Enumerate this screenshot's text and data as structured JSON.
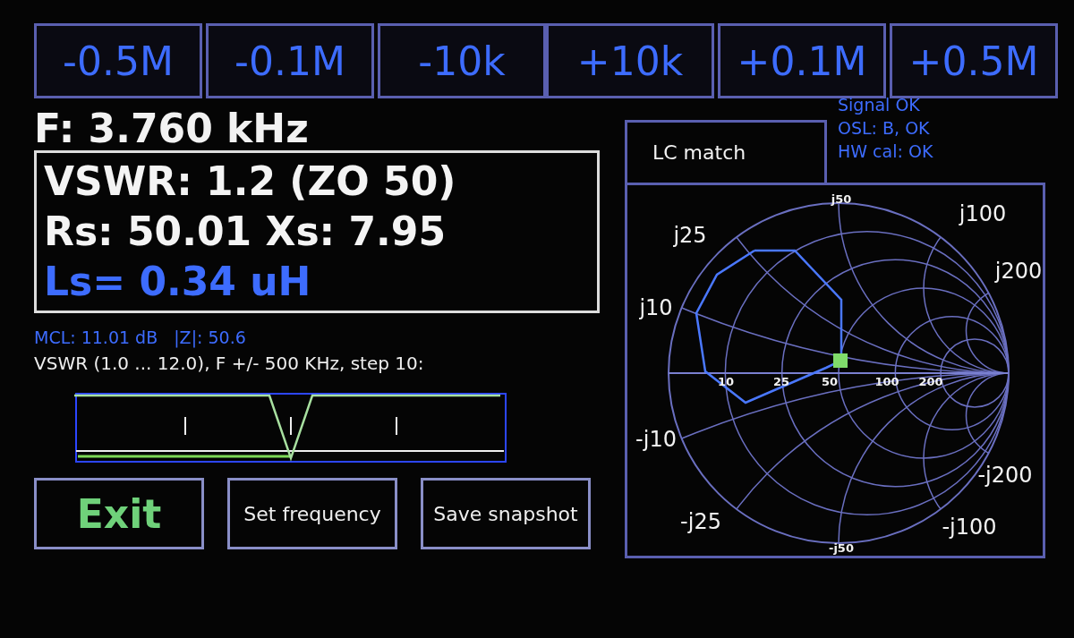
{
  "step_buttons_left": [
    {
      "label": "-0.5M"
    },
    {
      "label": "-0.1M"
    },
    {
      "label": "-10k"
    }
  ],
  "step_buttons_right": [
    {
      "label": "+10k"
    },
    {
      "label": "+0.1M"
    },
    {
      "label": "+0.5M"
    }
  ],
  "frequency": "F: 3.760 kHz",
  "readout": {
    "vswr": "VSWR: 1.2 (ZO 50)",
    "rs_xs": "Rs: 50.01 Xs: 7.95",
    "ls": "Ls= 0.34 uH"
  },
  "mcl": "MCL: 11.01 dB",
  "impedance": "|Z|: 50.6",
  "sweep_caption": "VSWR (1.0 ... 12.0), F +/- 500 KHz, step 10:",
  "buttons": [
    {
      "label": "Exit",
      "kind": "primary"
    },
    {
      "label": "Set frequency",
      "kind": "normal"
    },
    {
      "label": "Save snapshot",
      "kind": "normal"
    }
  ],
  "status": [
    "Signal OK",
    "OSL: B, OK",
    "HW cal: OK"
  ],
  "mode_tab": "LC match",
  "smith_labels": [
    "j50",
    "-j50",
    "j25",
    "j100",
    "j200",
    "j10",
    "-j10",
    "-j200",
    "-j25",
    "-j100"
  ],
  "smith_axis_labels": [
    "10",
    "25",
    "50",
    "100",
    "200"
  ]
}
